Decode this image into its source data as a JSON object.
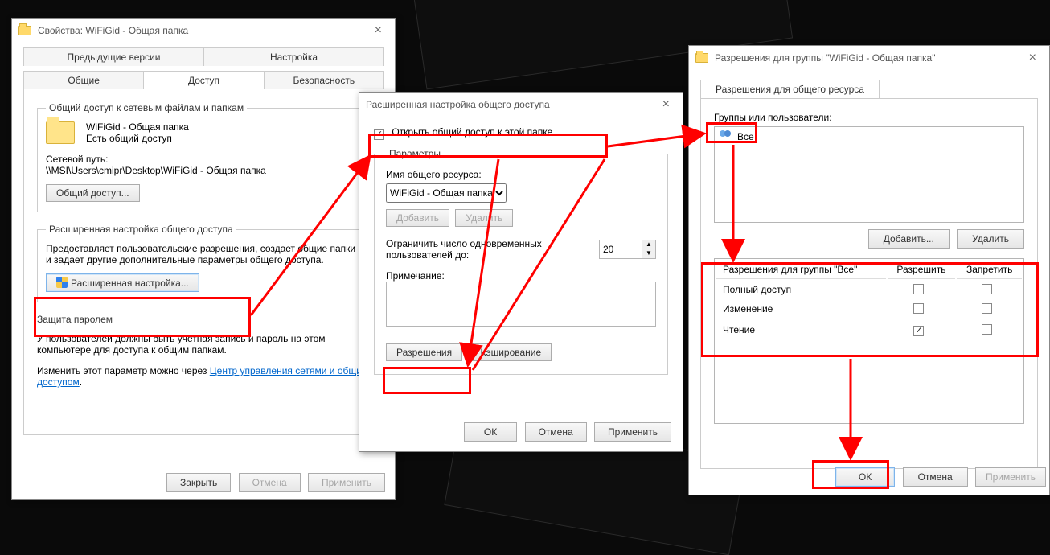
{
  "win1": {
    "title": "Свойства: WiFiGid - Общая папка",
    "tabs_top": [
      "Предыдущие версии",
      "Настройка"
    ],
    "tabs_bottom": [
      "Общие",
      "Доступ",
      "Безопасность"
    ],
    "fs1_legend": "Общий доступ к сетевым файлам и папкам",
    "folder_name": "WiFiGid - Общая папка",
    "share_state": "Есть общий доступ",
    "netpath_label": "Сетевой путь:",
    "netpath": "\\\\MSI\\Users\\cmipr\\Desktop\\WiFiGid - Общая папка",
    "share_btn": "Общий доступ...",
    "fs2_legend": "Расширенная настройка общего доступа",
    "fs2_text": "Предоставляет пользовательские разрешения, создает общие папки и задает другие дополнительные параметры общего доступа.",
    "adv_btn": "Расширенная настройка...",
    "fs3_legend": "Защита паролем",
    "fs3_text": "У пользователей должны быть учетная запись и пароль на этом компьютере для доступа к общим папкам.",
    "fs3_text2a": "Изменить этот параметр можно через ",
    "fs3_link": "Центр управления сетями и общим доступом",
    "close_btn": "Закрыть",
    "cancel_btn": "Отмена",
    "apply_btn": "Применить"
  },
  "win2": {
    "title": "Расширенная настройка общего доступа",
    "chk_label": "Открыть общий доступ к этой папке",
    "params_legend": "Параметры",
    "name_label": "Имя общего ресурса:",
    "name_value": "WiFiGid - Общая папка",
    "add_btn": "Добавить",
    "del_btn": "Удалить",
    "limit_label": "Ограничить число одновременных пользователей до:",
    "limit_value": "20",
    "note_label": "Примечание:",
    "perm_btn": "Разрешения",
    "cache_btn": "Кэширование",
    "ok_btn": "ОК",
    "cancel_btn": "Отмена",
    "apply_btn": "Применить"
  },
  "win3": {
    "title": "Разрешения для группы \"WiFiGid - Общая папка\"",
    "tab": "Разрешения для общего ресурса",
    "groups_label": "Группы или пользователи:",
    "user_all": "Все",
    "add_btn": "Добавить...",
    "del_btn": "Удалить",
    "perm_header": "Разрешения для группы \"Все\"",
    "col_allow": "Разрешить",
    "col_deny": "Запретить",
    "row_full": "Полный доступ",
    "row_change": "Изменение",
    "row_read": "Чтение",
    "ok_btn": "ОК",
    "cancel_btn": "Отмена",
    "apply_btn": "Применить"
  }
}
